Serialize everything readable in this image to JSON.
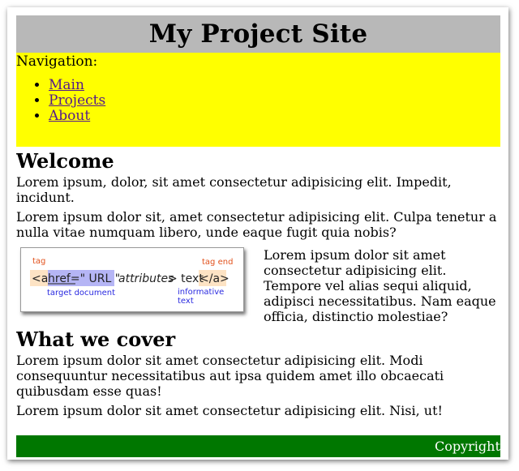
{
  "header": {
    "title": "My Project Site"
  },
  "nav": {
    "label": "Navigation:",
    "links": [
      "Main",
      "Projects",
      "About"
    ]
  },
  "welcome": {
    "title": "Welcome",
    "p1": "Lorem ipsum, dolor, sit amet consectetur adipisicing elit. Impedit, incidunt.",
    "p2": "Lorem ipsum dolor sit, amet consectetur adipisicing elit. Culpa tenetur a nulla vitae numquam libero, unde eaque fugit quia nobis?",
    "float_text": "Lorem ipsum dolor sit amet consectetur adipisicing elit. Tempore vel alias sequi aliquid, adipisci necessitatibus. Nam eaque officia, distinctio molestiae?"
  },
  "diagram": {
    "tag_label": "tag",
    "tag_end_label": "tag end",
    "open_tag": "<a",
    "href_part": "href=\" URL \"",
    "attributes": "attributes",
    "gt_text": "> text",
    "close_tag": "</a>",
    "target_document": "target document",
    "informative_line1": "informative",
    "informative_line2": "text"
  },
  "cover": {
    "title": "What we cover",
    "p3": "Lorem ipsum dolor sit amet consectetur adipisicing elit. Modi consequuntur necessitatibus aut ipsa quidem amet illo obcaecati quibusdam esse quas!",
    "p4": "Lorem ipsum dolor sit amet consectetur adipisicing elit. Nisi, ut!"
  },
  "footer": {
    "text": "Copyright"
  },
  "colors": {
    "header_bg": "#b8b8b8",
    "nav_bg": "#ffff00",
    "footer_bg": "#007700",
    "link": "#551a8b",
    "diagram_orange": "#e2521d",
    "diagram_blue": "#2a2ae0",
    "tag_highlight": "#fde3c4",
    "href_highlight": "#b5b5f5"
  }
}
